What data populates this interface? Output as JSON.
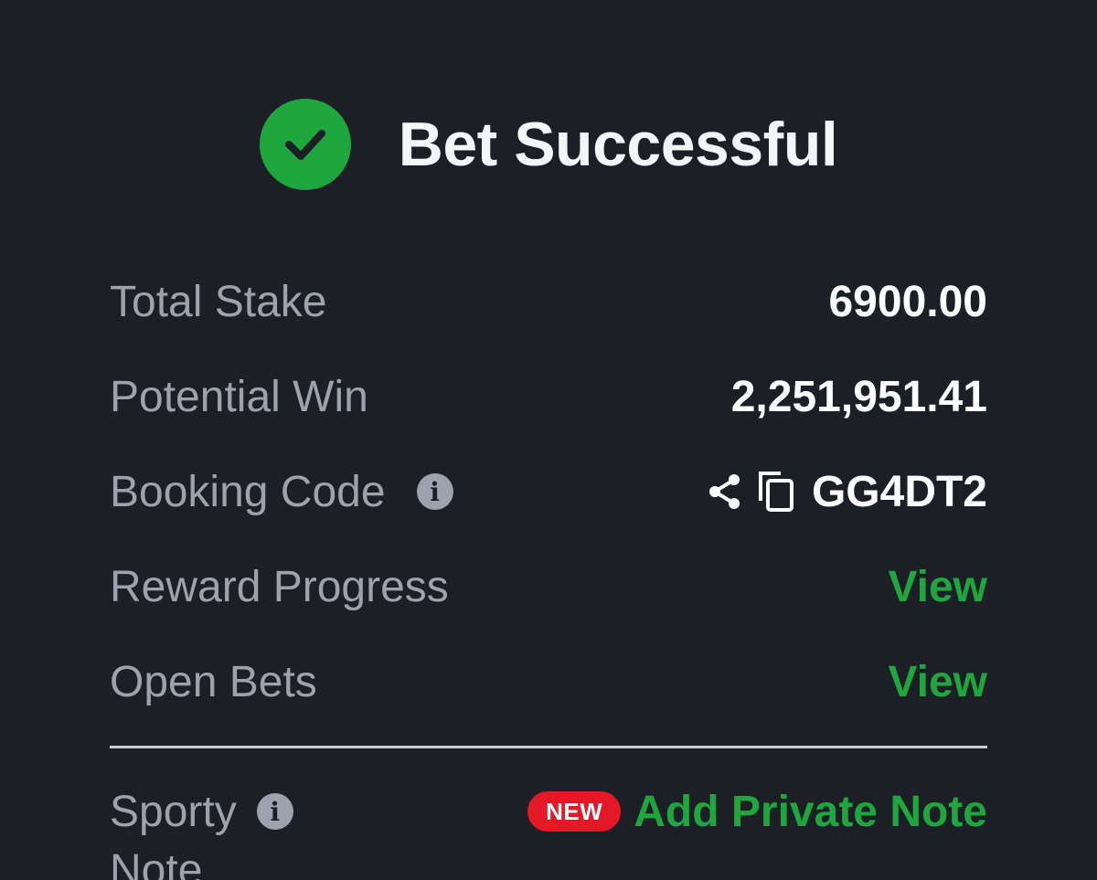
{
  "header": {
    "title": "Bet Successful",
    "icon": "check-circle-icon",
    "icon_color": "#1ea73e"
  },
  "summary": {
    "total_stake_label": "Total Stake",
    "total_stake_value": "6900.00",
    "potential_win_label": "Potential Win",
    "potential_win_value": "2,251,951.41",
    "booking_code_label": "Booking Code",
    "booking_code_value": "GG4DT2",
    "reward_progress_label": "Reward Progress",
    "reward_progress_link": "View",
    "open_bets_label": "Open Bets",
    "open_bets_link": "View"
  },
  "note": {
    "label_line1": "Sporty",
    "label_line2": "Note",
    "badge": "NEW",
    "action": "Add Private Note"
  },
  "colors": {
    "background": "#1c1f26",
    "accent_green": "#1ea73e",
    "badge_red": "#e41827",
    "label_gray": "#9da2ae"
  }
}
